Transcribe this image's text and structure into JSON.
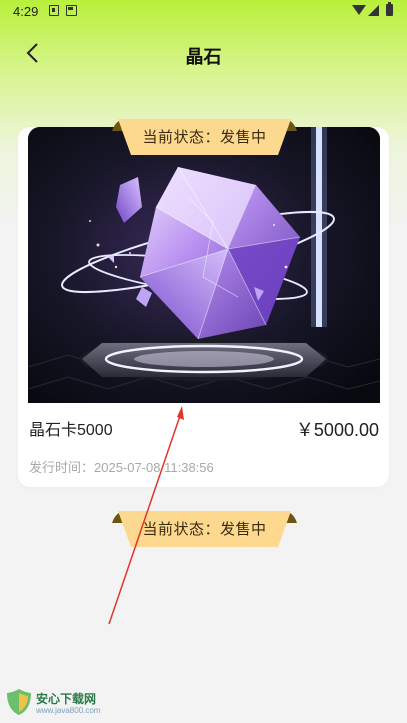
{
  "status_bar": {
    "time": "4:29"
  },
  "header": {
    "title": "晶石"
  },
  "status_label": "当前状态：发售中",
  "card": {
    "name": "晶石卡5000",
    "price": "￥5000.00",
    "issue_time": "发行时间：2025-07-08 11:38:56"
  },
  "second_item": {
    "status_label": "当前状态：发售中"
  },
  "watermark": {
    "brand": "安心下载网",
    "url": "www.java800.com"
  },
  "colors": {
    "header_gradient": "#b8f03a",
    "ribbon": "#fcd98e",
    "ribbon_edge": "#6b5512",
    "price_text": "#222222",
    "time_text": "#a8a8a8",
    "annotation": "#e0352b"
  },
  "icons": [
    "back-arrow-icon",
    "wifi-icon",
    "signal-icon",
    "battery-icon"
  ]
}
